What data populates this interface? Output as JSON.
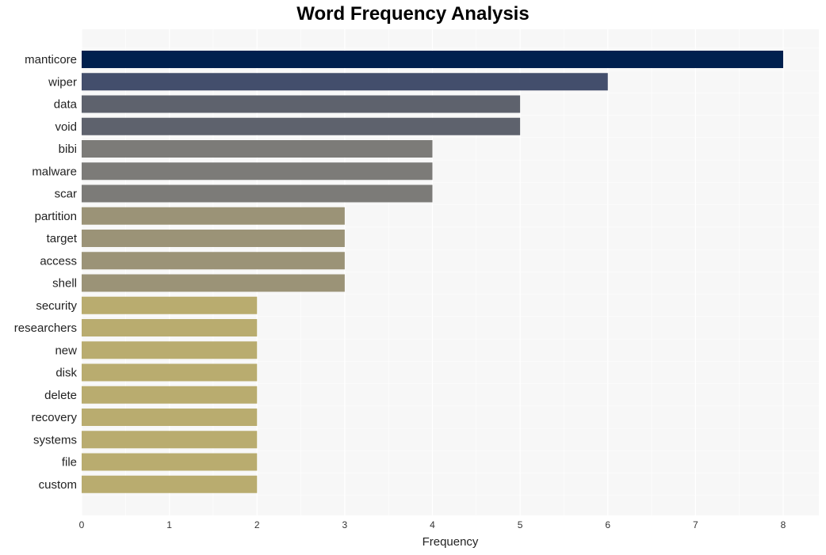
{
  "chart_data": {
    "type": "bar",
    "orientation": "horizontal",
    "title": "Word Frequency Analysis",
    "xlabel": "Frequency",
    "ylabel": "",
    "xlim": [
      0,
      8.4
    ],
    "xticks": [
      0,
      1,
      2,
      3,
      4,
      5,
      6,
      7,
      8
    ],
    "grid": true,
    "legend": "none",
    "categories": [
      "manticore",
      "wiper",
      "data",
      "void",
      "bibi",
      "malware",
      "scar",
      "partition",
      "target",
      "access",
      "shell",
      "security",
      "researchers",
      "new",
      "disk",
      "delete",
      "recovery",
      "systems",
      "file",
      "custom"
    ],
    "values": [
      8,
      6,
      5,
      5,
      4,
      4,
      4,
      3,
      3,
      3,
      3,
      2,
      2,
      2,
      2,
      2,
      2,
      2,
      2,
      2
    ],
    "colors_by_value": {
      "8": "#00204e",
      "6": "#434e6c",
      "5": "#5e626d",
      "4": "#7c7b78",
      "3": "#9b9377",
      "2": "#b9ac6f"
    },
    "plot_background": "#f7f7f7",
    "grid_color": "#ffffff"
  }
}
